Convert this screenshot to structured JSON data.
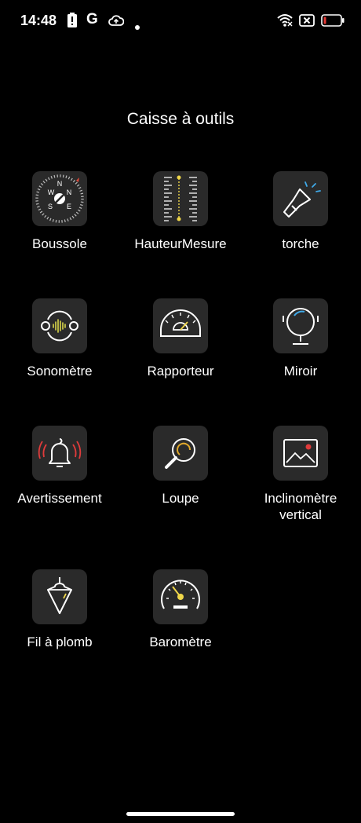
{
  "status": {
    "time": "14:48",
    "g_letter": "G"
  },
  "page": {
    "title": "Caisse à outils"
  },
  "tools": [
    {
      "label": "Boussole",
      "icon": "compass-icon"
    },
    {
      "label": "HauteurMesure",
      "icon": "height-ruler-icon"
    },
    {
      "label": "torche",
      "icon": "flashlight-icon"
    },
    {
      "label": "Sonomètre",
      "icon": "sound-meter-icon"
    },
    {
      "label": "Rapporteur",
      "icon": "protractor-icon"
    },
    {
      "label": "Miroir",
      "icon": "mirror-icon"
    },
    {
      "label": "Avertissement",
      "icon": "alarm-bell-icon"
    },
    {
      "label": "Loupe",
      "icon": "magnifier-icon"
    },
    {
      "label": "Inclinomètre vertical",
      "icon": "picture-level-icon"
    },
    {
      "label": "Fil à plomb",
      "icon": "plumb-bob-icon"
    },
    {
      "label": "Baromètre",
      "icon": "barometer-icon"
    }
  ],
  "compass": {
    "north": "N",
    "south": "S",
    "east": "E",
    "west": "W"
  },
  "colors": {
    "background": "#000000",
    "tile": "#2a2a2a",
    "accent_yellow": "#f0d74a",
    "accent_blue": "#3fa9e8",
    "alert_red": "#e03b3b"
  }
}
